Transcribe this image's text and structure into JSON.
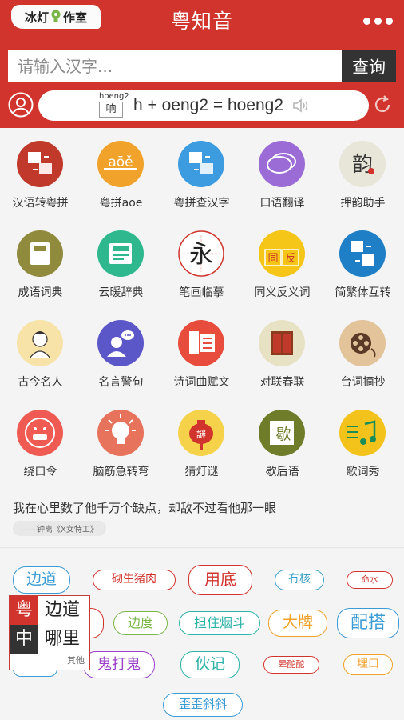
{
  "header": {
    "logo": {
      "left": "冰灯",
      "right": "作室"
    },
    "title": "粤知音",
    "colors": {
      "brand": "#d0342c",
      "dark": "#333333"
    }
  },
  "search": {
    "placeholder": "请输入汉字...",
    "button": "查询"
  },
  "pronunciation": {
    "roman": "hoeng2",
    "hanzi": "响",
    "formula": "h + oeng2 = hoeng2"
  },
  "tools": [
    {
      "label": "汉语转粤拼",
      "icon": "chinese-to-jyutping-icon",
      "color": "#c0392b"
    },
    {
      "label": "粤拼aoe",
      "icon": "jyutping-aoe-icon",
      "color": "#f0a22a"
    },
    {
      "label": "粤拼查汉字",
      "icon": "jyutping-lookup-icon",
      "color": "#3d9be0"
    },
    {
      "label": "口语翻译",
      "icon": "speech-bubble-icon",
      "color": "#9b6bd6"
    },
    {
      "label": "押韵助手",
      "icon": "rhyme-icon",
      "color": "#e8e6d8"
    },
    {
      "label": "成语词典",
      "icon": "idiom-book-icon",
      "color": "#8f8a3c"
    },
    {
      "label": "云暖辞典",
      "icon": "dictionary-icon",
      "color": "#2fb88d"
    },
    {
      "label": "笔画临摹",
      "icon": "stroke-icon",
      "color": "#ffffff"
    },
    {
      "label": "同义反义词",
      "icon": "synonym-icon",
      "color": "#f5c518"
    },
    {
      "label": "简繁体互转",
      "icon": "simplified-traditional-icon",
      "color": "#1e7fc6"
    },
    {
      "label": "古今名人",
      "icon": "famous-person-icon",
      "color": "#f7e3a8"
    },
    {
      "label": "名言警句",
      "icon": "quote-person-icon",
      "color": "#5b57c9"
    },
    {
      "label": "诗词曲赋文",
      "icon": "poetry-icon",
      "color": "#e74c3c"
    },
    {
      "label": "对联春联",
      "icon": "couplet-door-icon",
      "color": "#e8e2c4"
    },
    {
      "label": "台词摘抄",
      "icon": "film-reel-icon",
      "color": "#e3c39a"
    },
    {
      "label": "绕口令",
      "icon": "tongue-twister-icon",
      "color": "#ef5b53"
    },
    {
      "label": "脑筋急转弯",
      "icon": "brain-bulb-icon",
      "color": "#e8735c"
    },
    {
      "label": "猜灯谜",
      "icon": "lantern-riddle-icon",
      "color": "#f5d24a"
    },
    {
      "label": "歇后语",
      "icon": "xiehouyu-icon",
      "color": "#6f7d2a"
    },
    {
      "label": "歌词秀",
      "icon": "music-note-icon",
      "color": "#f3c31c"
    }
  ],
  "quote": {
    "text": "我在心里数了他千万个缺点，却敌不过看他那一眼",
    "source": "——钟离《X女特工》"
  },
  "tags": [
    {
      "text": "边道",
      "color": "#3a9bd5",
      "size": "lg"
    },
    {
      "text": "砌生猪肉",
      "color": "#d0342c",
      "size": "sm"
    },
    {
      "text": "用底",
      "color": "#d0342c",
      "size": "lg"
    },
    {
      "text": "冇核",
      "color": "#3aa0c9",
      "size": "sm"
    },
    {
      "text": "命水",
      "color": "#d0342c",
      "size": "xs"
    },
    {
      "text": "边度",
      "color": "#7ab648",
      "size": "md"
    },
    {
      "text": "担住烟斗",
      "color": "#2db3a8",
      "size": "md"
    },
    {
      "text": "大牌",
      "color": "#f0a22a",
      "size": "lg"
    },
    {
      "text": "配搭",
      "color": "#3a9bd5",
      "size": "xl"
    },
    {
      "text": "鬼打鬼",
      "color": "#9b40c9",
      "size": "lg"
    },
    {
      "text": "伙记",
      "color": "#2db3a8",
      "size": "lg"
    },
    {
      "text": "晕酡酡",
      "color": "#d0342c",
      "size": "xs"
    },
    {
      "text": "埋口",
      "color": "#f0a22a",
      "size": "sm"
    },
    {
      "text": "歪歪斜斜",
      "color": "#3a9bd5",
      "size": "md"
    }
  ],
  "popup": {
    "label_a": "粤",
    "label_b": "中",
    "word_a": "边道",
    "word_b": "哪里",
    "other": "其他"
  }
}
